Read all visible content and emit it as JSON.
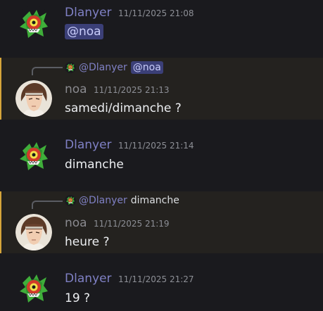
{
  "colors": {
    "background": "#1a1a1e",
    "highlight_bg": "#24221f",
    "highlight_bar": "#d6a53b",
    "dlanyer_name": "#7f80c4",
    "noa_name": "#8a8a8f",
    "mention_bg": "#3b3f77",
    "mention_fg": "#c9cdfb"
  },
  "messages": [
    {
      "author": "Dlanyer",
      "avatar": "green-monster-avatar",
      "timestamp": "11/11/2025 21:08",
      "mention": "@noa"
    },
    {
      "reply_to": {
        "author": "@Dlanyer",
        "mention": "@noa"
      },
      "author": "noa",
      "avatar": "anime-character-avatar",
      "timestamp": "11/11/2025 21:13",
      "text": "samedi/dimanche ?",
      "highlighted": true
    },
    {
      "author": "Dlanyer",
      "avatar": "green-monster-avatar",
      "timestamp": "11/11/2025 21:14",
      "text": "dimanche"
    },
    {
      "reply_to": {
        "author": "@Dlanyer",
        "text": "dimanche"
      },
      "author": "noa",
      "avatar": "anime-character-avatar",
      "timestamp": "11/11/2025 21:19",
      "text": "heure ?",
      "highlighted": true
    },
    {
      "author": "Dlanyer",
      "avatar": "green-monster-avatar",
      "timestamp": "11/11/2025 21:27",
      "text": "19 ?"
    }
  ]
}
